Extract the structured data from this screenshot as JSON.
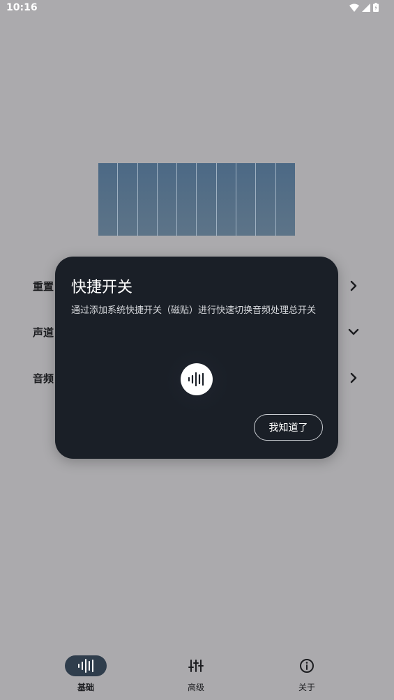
{
  "status_bar": {
    "time": "10:16"
  },
  "settings": {
    "rows": [
      {
        "label": "重置",
        "icon": "chevron-right-icon"
      },
      {
        "label": "声道",
        "icon": "chevron-down-icon"
      },
      {
        "label": "音频",
        "icon": "chevron-right-icon"
      }
    ]
  },
  "dialog": {
    "title": "快捷开关",
    "description": "通过添加系统快捷开关（磁贴）进行快速切换音频处理总开关",
    "tile_icon": "audio-waveform-icon",
    "confirm_label": "我知道了"
  },
  "bottom_nav": {
    "items": [
      {
        "label": "基础",
        "icon": "waveform-icon",
        "active": true
      },
      {
        "label": "高级",
        "icon": "sliders-icon",
        "active": false
      },
      {
        "label": "关于",
        "icon": "info-icon",
        "active": false
      }
    ]
  },
  "colors": {
    "scrim_background": "#abaaad",
    "dialog_background": "#1a1f27",
    "nav_active_pill": "#2f3d4c",
    "eq_bar": "#4c6985"
  }
}
